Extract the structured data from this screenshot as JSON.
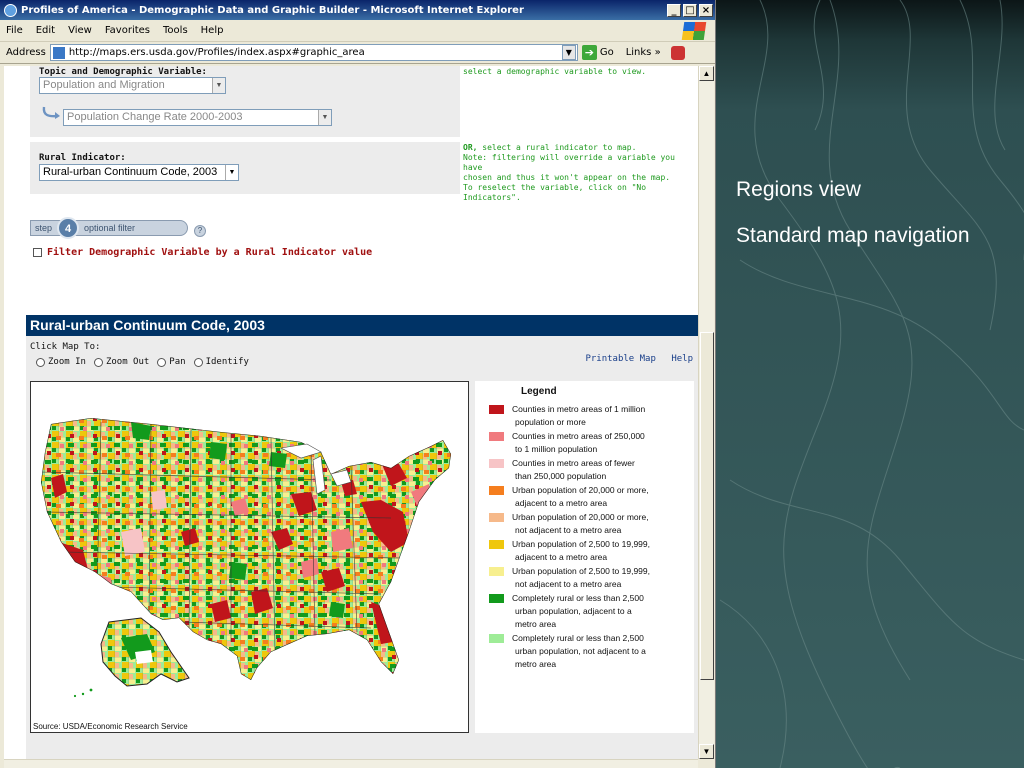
{
  "window": {
    "title": "Profiles of America - Demographic Data and Graphic Builder - Microsoft Internet Explorer",
    "minimize": "_",
    "maximize": "□",
    "close": "×"
  },
  "menu": [
    "File",
    "Edit",
    "View",
    "Favorites",
    "Tools",
    "Help"
  ],
  "address": {
    "label": "Address",
    "url": "http://maps.ers.usda.gov/Profiles/index.aspx#graphic_area",
    "go": "Go",
    "links": "Links",
    "chevron": "»"
  },
  "form": {
    "topic_label": "Topic and Demographic Variable:",
    "topic_value": "Population and Migration",
    "variable_value": "Population Change Rate 2000-2003",
    "topic_hint": "select a demographic variable to view.",
    "rural_label": "Rural Indicator:",
    "rural_value": "Rural-urban Continuum Code, 2003",
    "or_word": "OR,",
    "rural_hint_1": " select a rural indicator to map.",
    "rural_hint_2": "Note: filtering will override a variable you have",
    "rural_hint_3": "chosen and thus it won't appear on the map.",
    "rural_hint_4": "To reselect the variable, click on \"No",
    "rural_hint_5": "Indicators\"."
  },
  "step": {
    "word": "step",
    "number": "4",
    "text": "optional filter",
    "help": "?"
  },
  "filter_label": "Filter Demographic Variable by a Rural Indicator value",
  "map": {
    "header": "Rural-urban Continuum Code, 2003",
    "click_map_to": "Click Map To:",
    "tools": [
      "Zoom In",
      "Zoom Out",
      "Pan",
      "Identify"
    ],
    "printable": "Printable Map",
    "help": "Help",
    "source": "Source: USDA/Economic Research Service"
  },
  "legend": {
    "title": "Legend",
    "items": [
      {
        "color": "#c0151b",
        "lines": [
          "Counties in metro areas of 1 million",
          "population or more"
        ]
      },
      {
        "color": "#f07a7e",
        "lines": [
          "Counties in metro areas of 250,000",
          "to 1 million population"
        ]
      },
      {
        "color": "#f7c4c6",
        "lines": [
          "Counties in metro areas of fewer",
          "than 250,000 population"
        ]
      },
      {
        "color": "#f57e1e",
        "lines": [
          "Urban population of 20,000 or more,",
          "adjacent to a metro area"
        ]
      },
      {
        "color": "#f6b98a",
        "lines": [
          "Urban population of 20,000 or more,",
          "not adjacent to a metro area"
        ]
      },
      {
        "color": "#efc70c",
        "lines": [
          "Urban population of 2,500 to 19,999,",
          "adjacent to a metro area"
        ]
      },
      {
        "color": "#f7ef8f",
        "lines": [
          "Urban population of 2,500 to 19,999,",
          "not adjacent to a metro area"
        ]
      },
      {
        "color": "#129a1c",
        "lines": [
          "Completely rural or less than 2,500",
          "urban population, adjacent to a",
          "metro area"
        ]
      },
      {
        "color": "#9eec97",
        "lines": [
          "Completely rural or less than 2,500",
          "urban population, not adjacent to a",
          "metro area"
        ]
      }
    ]
  },
  "slide": {
    "bullets": [
      "Regions view",
      "Standard map navigation"
    ]
  }
}
